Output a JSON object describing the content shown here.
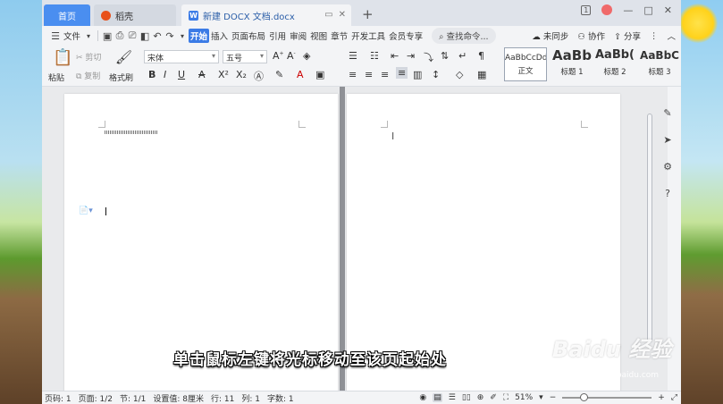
{
  "titlebar": {
    "tab_home": "首页",
    "tab_daoke": "稻壳",
    "tab_doc": "新建 DOCX 文档.docx",
    "new_tab": "+",
    "badge": "1",
    "win_min": "—",
    "win_max": "□",
    "win_close": "✕"
  },
  "menubar": {
    "file": "文件",
    "items": [
      "开始",
      "插入",
      "页面布局",
      "引用",
      "审阅",
      "视图",
      "章节",
      "开发工具",
      "会员专享"
    ],
    "search": "查找命令...",
    "sync": "未同步",
    "collab": "协作",
    "share": "分享"
  },
  "ribbon": {
    "paste": "粘贴",
    "cut": "剪切",
    "copy": "复制",
    "format_painter": "格式刷",
    "font_name": "宋体",
    "font_size": "五号"
  },
  "styles": {
    "normal_sample": "AaBbCcDd",
    "normal_label": "正文",
    "h1_sample": "AaBb",
    "h1_label": "标题 1",
    "h2_sample": "AaBb(",
    "h2_label": "标题 2",
    "h3_sample": "AaBbC",
    "h3_label": "标题 3"
  },
  "status": {
    "page_no": "页码: 1",
    "pages": "页面: 1/2",
    "section": "节: 1/1",
    "setting": "设置值: 8厘米",
    "row": "行: 11",
    "col": "列: 1",
    "words": "字数: 1",
    "zoom": "51%",
    "zoom_value": 0.51
  },
  "caption": "单击鼠标左键将光标移动至该页起始处",
  "watermark": {
    "brand": "Baidu 经验",
    "url": "jingyan.baidu.com"
  }
}
